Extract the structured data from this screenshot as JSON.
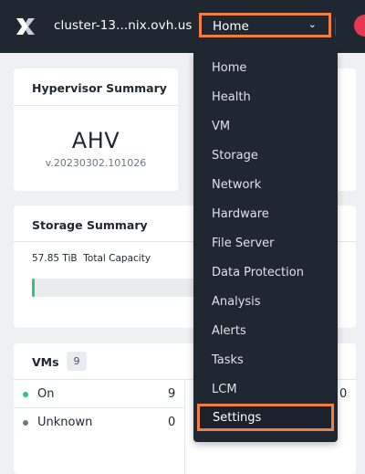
{
  "header": {
    "logo_icon": "nutanix-x-logo",
    "cluster_name": "cluster-13...nix.ovh.us",
    "nav_selected": "Home",
    "nav_chevron": "⌄"
  },
  "nav_menu": {
    "items": [
      "Home",
      "Health",
      "VM",
      "Storage",
      "Network",
      "Hardware",
      "File Server",
      "Data Protection",
      "Analysis",
      "Alerts",
      "Tasks",
      "LCM"
    ],
    "highlighted_item": "Settings"
  },
  "hypervisor_summary": {
    "title": "Hypervisor Summary",
    "hypervisor": "AHV",
    "version": "v.20230302.101026"
  },
  "storage_summary": {
    "title": "Storage Summary",
    "capacity_value": "57.85 TiB",
    "capacity_label": "Total Capacity",
    "used_fraction": 0.02
  },
  "vms": {
    "title": "VMs",
    "count": "9",
    "rows": [
      {
        "label": "On",
        "value": "9",
        "dot_color": "#2bc77a"
      },
      {
        "label": "Unknown",
        "value": "0",
        "dot_color": "#6b7785"
      }
    ]
  },
  "partial_right_values": [
    "0"
  ],
  "colors": {
    "topbar": "#1f2731",
    "highlight": "#f07e42",
    "success": "#2bc77a",
    "avatar": "#e53950"
  }
}
